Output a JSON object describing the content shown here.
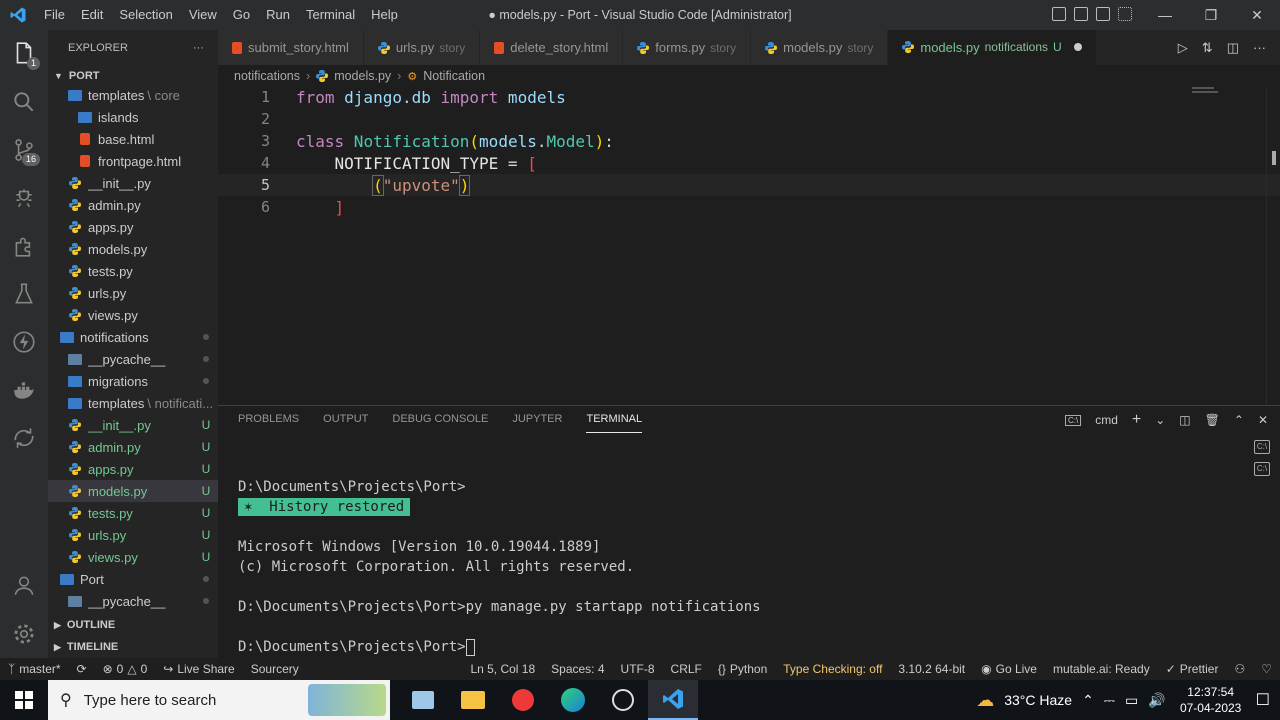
{
  "titlebar": {
    "menu": [
      "File",
      "Edit",
      "Selection",
      "View",
      "Go",
      "Run",
      "Terminal",
      "Help"
    ],
    "title": "● models.py - Port - Visual Studio Code [Administrator]"
  },
  "activity": {
    "explorer_badge": "1",
    "scm_badge": "16"
  },
  "sidebar": {
    "header": "EXPLORER",
    "more": "···",
    "root": "PORT",
    "rows": [
      {
        "label": "templates",
        "sub": "\\ core",
        "type": "folder",
        "indent": 20,
        "status": ""
      },
      {
        "label": "islands",
        "sub": "",
        "type": "folder",
        "indent": 30,
        "status": ""
      },
      {
        "label": "base.html",
        "sub": "",
        "type": "html",
        "indent": 30,
        "status": ""
      },
      {
        "label": "frontpage.html",
        "sub": "",
        "type": "html",
        "indent": 30,
        "status": ""
      },
      {
        "label": "__init__.py",
        "sub": "",
        "type": "py",
        "indent": 20,
        "status": ""
      },
      {
        "label": "admin.py",
        "sub": "",
        "type": "py",
        "indent": 20,
        "status": ""
      },
      {
        "label": "apps.py",
        "sub": "",
        "type": "py",
        "indent": 20,
        "status": ""
      },
      {
        "label": "models.py",
        "sub": "",
        "type": "py",
        "indent": 20,
        "status": ""
      },
      {
        "label": "tests.py",
        "sub": "",
        "type": "py",
        "indent": 20,
        "status": ""
      },
      {
        "label": "urls.py",
        "sub": "",
        "type": "py",
        "indent": 20,
        "status": ""
      },
      {
        "label": "views.py",
        "sub": "",
        "type": "py",
        "indent": 20,
        "status": ""
      },
      {
        "label": "notifications",
        "sub": "",
        "type": "folder-open",
        "indent": 12,
        "status": "dot"
      },
      {
        "label": "__pycache__",
        "sub": "",
        "type": "folder-grey",
        "indent": 20,
        "status": "dot"
      },
      {
        "label": "migrations",
        "sub": "",
        "type": "folder",
        "indent": 20,
        "status": "dot"
      },
      {
        "label": "templates",
        "sub": "\\ notificati...",
        "type": "folder",
        "indent": 20,
        "status": ""
      },
      {
        "label": "__init__.py",
        "sub": "",
        "type": "py",
        "indent": 20,
        "status": "U"
      },
      {
        "label": "admin.py",
        "sub": "",
        "type": "py",
        "indent": 20,
        "status": "U"
      },
      {
        "label": "apps.py",
        "sub": "",
        "type": "py",
        "indent": 20,
        "status": "U"
      },
      {
        "label": "models.py",
        "sub": "",
        "type": "py",
        "indent": 20,
        "status": "U",
        "selected": true
      },
      {
        "label": "tests.py",
        "sub": "",
        "type": "py",
        "indent": 20,
        "status": "U"
      },
      {
        "label": "urls.py",
        "sub": "",
        "type": "py",
        "indent": 20,
        "status": "U"
      },
      {
        "label": "views.py",
        "sub": "",
        "type": "py",
        "indent": 20,
        "status": "U"
      },
      {
        "label": "Port",
        "sub": "",
        "type": "folder-open",
        "indent": 12,
        "status": "dot"
      },
      {
        "label": "__pycache__",
        "sub": "",
        "type": "folder-grey",
        "indent": 20,
        "status": "dot"
      }
    ],
    "outline": "OUTLINE",
    "timeline": "TIMELINE"
  },
  "tabs": [
    {
      "label": "submit_story.html",
      "desc": "",
      "type": "html"
    },
    {
      "label": "urls.py",
      "desc": "story",
      "type": "py"
    },
    {
      "label": "delete_story.html",
      "desc": "",
      "type": "html"
    },
    {
      "label": "forms.py",
      "desc": "story",
      "type": "py"
    },
    {
      "label": "models.py",
      "desc": "story",
      "type": "py"
    },
    {
      "label": "models.py",
      "desc": "notifications",
      "type": "py",
      "active": true,
      "status": "U"
    }
  ],
  "breadcrumb": {
    "folder": "notifications",
    "file": "models.py",
    "symbol": "Notification"
  },
  "editor": {
    "line_numbers": [
      "1",
      "2",
      "3",
      "4",
      "5",
      "6"
    ],
    "l1": {
      "kw1": "from",
      "mod": " django.db ",
      "kw2": "import",
      "name": " models"
    },
    "l3": {
      "kw": "class",
      "cls": " Notification",
      "open": "(",
      "base1": "models",
      "dot": ".",
      "base2": "Model",
      "close": ")",
      "colon": ":"
    },
    "l4": {
      "indent": "    ",
      "name": "NOTIFICATION_TYPE",
      "eq": " = ",
      "br": "["
    },
    "l5": {
      "indent": "        ",
      "open": "(",
      "str": "\"upvote\"",
      "close": ")"
    },
    "l6": {
      "indent": "    ",
      "br": "]"
    }
  },
  "panel": {
    "tabs": [
      "PROBLEMS",
      "OUTPUT",
      "DEBUG CONSOLE",
      "JUPYTER",
      "TERMINAL"
    ],
    "active_tab": "TERMINAL",
    "shell": "cmd",
    "terminal": {
      "l1": "D:\\Documents\\Projects\\Port>",
      "history": "✶  History restored",
      "l3": "Microsoft Windows [Version 10.0.19044.1889]",
      "l4": "(c) Microsoft Corporation. All rights reserved.",
      "l5": "D:\\Documents\\Projects\\Port>py manage.py startapp notifications",
      "l6": "D:\\Documents\\Projects\\Port>"
    }
  },
  "statusbar": {
    "branch": "master*",
    "errors": "0",
    "warnings": "0",
    "liveshare": "Live Share",
    "sourcery": "Sourcery",
    "position": "Ln 5, Col 18",
    "spaces": "Spaces: 4",
    "encoding": "UTF-8",
    "eol": "CRLF",
    "language": "Python",
    "typecheck": "Type Checking: off",
    "interpreter": "3.10.2 64-bit",
    "golive": "Go Live",
    "mutable": "mutable.ai: Ready",
    "prettier": "Prettier"
  },
  "taskbar": {
    "search_placeholder": "Type here to search",
    "weather": "33°C  Haze",
    "time": "12:37:54",
    "date": "07-04-2023"
  },
  "colors": {
    "accent": "#007acc",
    "untracked": "#73c991",
    "keyword": "#c586c0",
    "class": "#4ec9b0",
    "string": "#ce9178"
  }
}
